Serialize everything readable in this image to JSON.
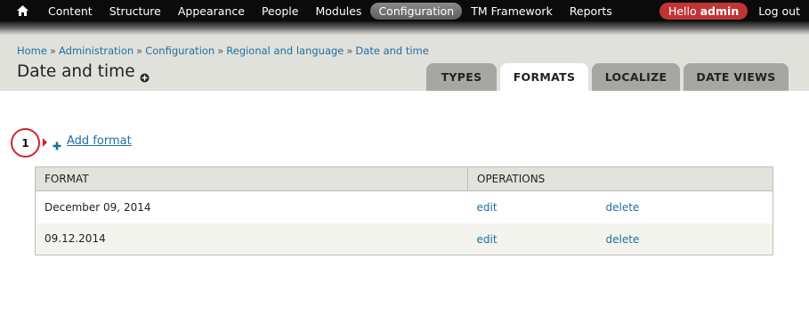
{
  "toolbar": {
    "home_icon": "home-icon",
    "items": [
      "Content",
      "Structure",
      "Appearance",
      "People",
      "Modules",
      "Configuration",
      "TM Framework",
      "Reports"
    ],
    "active_item": "Configuration",
    "hello_prefix": "Hello",
    "user": "admin",
    "logout": "Log out"
  },
  "breadcrumb": [
    "Home",
    "Administration",
    "Configuration",
    "Regional and language",
    "Date and time"
  ],
  "page_title": "Date and time",
  "tabs": [
    {
      "label": "TYPES",
      "active": false
    },
    {
      "label": "FORMATS",
      "active": true
    },
    {
      "label": "LOCALIZE",
      "active": false
    },
    {
      "label": "DATE VIEWS",
      "active": false
    }
  ],
  "step_marker": "1",
  "add_format_label": "Add format",
  "table": {
    "headers": [
      "FORMAT",
      "OPERATIONS"
    ],
    "rows": [
      {
        "format": "December 09, 2014",
        "edit": "edit",
        "delete": "delete"
      },
      {
        "format": "09.12.2014",
        "edit": "edit",
        "delete": "delete"
      }
    ]
  },
  "colors": {
    "toolbar_bg": "#0b0b0b",
    "header_bg": "#e1e1dc",
    "link": "#1f6f9f",
    "hello_badge": "#bf3535",
    "step_marker": "#d2232a"
  }
}
